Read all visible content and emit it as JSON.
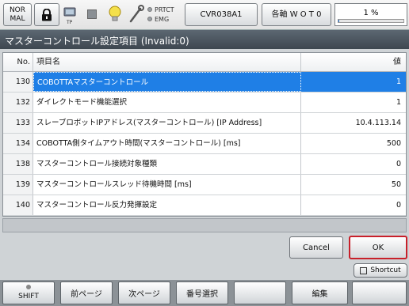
{
  "toolbar": {
    "mode_line1": "NOR",
    "mode_line2": "MAL",
    "tp_label": "TP",
    "prtct_label": "PRTCT",
    "emg_label": "EMG",
    "robot_name": "CVR038A1",
    "axis_label": "各軸 W O T 0",
    "speed": "1 %",
    "speed_fraction": 0.01
  },
  "title": "マスターコントロール設定項目 (Invalid:0)",
  "table": {
    "headers": {
      "no": "No.",
      "name": "項目名",
      "value": "値"
    },
    "rows": [
      {
        "no": "130",
        "name": "COBOTTAマスターコントロール",
        "value": "1",
        "selected": true
      },
      {
        "no": "132",
        "name": "ダイレクトモード機能選択",
        "value": "1"
      },
      {
        "no": "133",
        "name": "スレーブロボットIPアドレス(マスターコントロール) [IP Address]",
        "value": "10.4.113.14"
      },
      {
        "no": "134",
        "name": "COBOTTA側タイムアウト時間(マスターコントロール) [ms]",
        "value": "500"
      },
      {
        "no": "138",
        "name": "マスターコントロール接続対象種類",
        "value": "0"
      },
      {
        "no": "139",
        "name": "マスターコントロールスレッド待機時間 [ms]",
        "value": "50"
      },
      {
        "no": "140",
        "name": "マスターコントロール反力発揮設定",
        "value": "0"
      }
    ]
  },
  "buttons": {
    "cancel": "Cancel",
    "ok": "OK",
    "shortcut": "Shortcut"
  },
  "fkeys": {
    "shift": "SHIFT",
    "prev_page": "前ページ",
    "next_page": "次ページ",
    "number_select": "番号選択",
    "edit": "編集"
  },
  "colors": {
    "selected_row": "#1f7fe6",
    "ok_border": "#c8202a",
    "title_bar": "#4a545e"
  }
}
